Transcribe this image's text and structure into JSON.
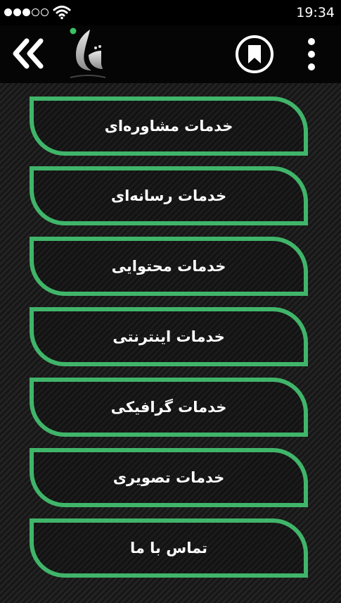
{
  "status_bar": {
    "signal": "signal-dots-icon",
    "wifi": "wifi-icon",
    "time": "19:34"
  },
  "app_bar": {
    "back_icon": "double-chevron-left-icon",
    "logo": "app-logo",
    "bookmark_icon": "bookmark-icon",
    "more_icon": "more-vertical-icon",
    "colors": {
      "accent": "#40b56a",
      "bar": "#050505"
    }
  },
  "menu": {
    "items": [
      {
        "label": "خدمات مشاوره‌ای"
      },
      {
        "label": "خدمات رسانه‌ای"
      },
      {
        "label": "خدمات محتوایی"
      },
      {
        "label": "خدمات اینترنتی"
      },
      {
        "label": "خدمات گرافیکی"
      },
      {
        "label": "خدمات تصویری"
      },
      {
        "label": "تماس با ما"
      }
    ]
  }
}
